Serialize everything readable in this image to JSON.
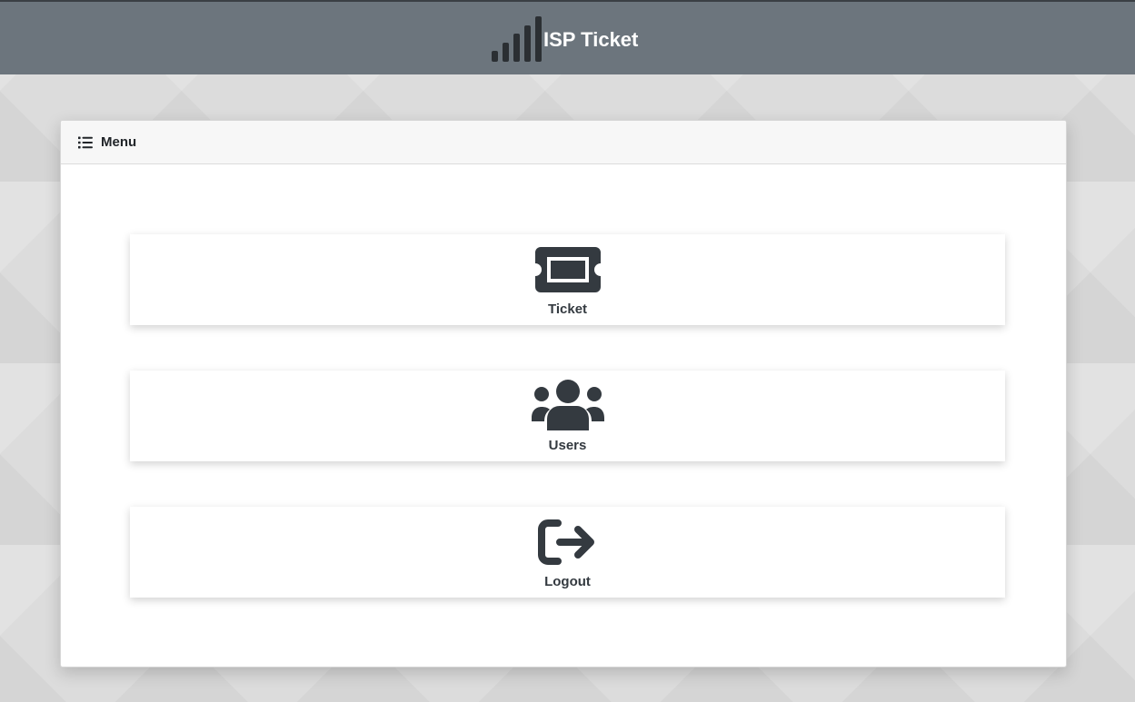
{
  "header": {
    "title": "ISP Ticket",
    "logo_icon": "signal-bars-icon",
    "background_color": "#6c757d"
  },
  "menu": {
    "title": "Menu",
    "title_icon": "list-icon"
  },
  "tiles": [
    {
      "label": "Ticket",
      "icon": "ticket-icon"
    },
    {
      "label": "Users",
      "icon": "users-icon"
    },
    {
      "label": "Logout",
      "icon": "logout-icon"
    }
  ],
  "colors": {
    "icon": "#343a40",
    "text": "#343a40",
    "card_background": "#ffffff",
    "card_header_background": "#f7f7f7"
  }
}
